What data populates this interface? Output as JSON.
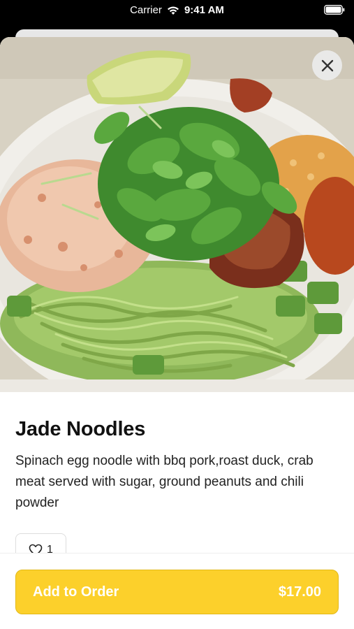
{
  "status_bar": {
    "carrier": "Carrier",
    "time": "9:41 AM"
  },
  "item": {
    "image_alt": "Jade Noodles dish photo",
    "title": "Jade Noodles",
    "description": "Spinach egg noodle with bbq pork,roast duck, crab meat served with sugar, ground peanuts and chili powder",
    "likes": "1"
  },
  "footer": {
    "add_label": "Add to Order",
    "price": "$17.00"
  },
  "colors": {
    "accent": "#fcd02b",
    "button_text": "#ffffff"
  },
  "icons": {
    "close": "close-icon",
    "like": "heart-icon",
    "wifi": "wifi-icon",
    "battery": "battery-icon"
  }
}
